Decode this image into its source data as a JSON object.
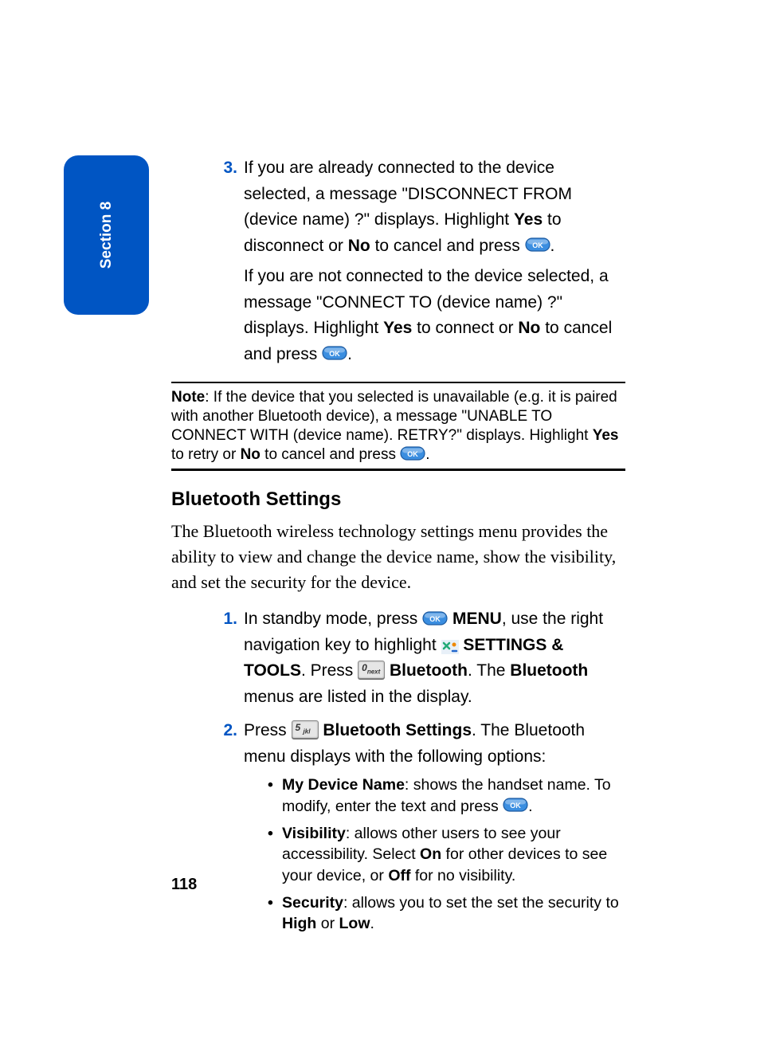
{
  "section_tab": "Section 8",
  "page_number": "118",
  "step3": {
    "marker": "3.",
    "p1_a": "If you are already connected to the device selected, a message \"DISCONNECT FROM (device name) ?\" displays. Highlight ",
    "p1_yes": "Yes",
    "p1_b": " to disconnect or ",
    "p1_no": "No",
    "p1_c": " to cancel and press ",
    "p1_d": ".",
    "p2_a": "If you are not connected to the device selected, a message \"CONNECT TO (device name) ?\" displays. Highlight ",
    "p2_yes": "Yes",
    "p2_b": " to connect or ",
    "p2_no": "No",
    "p2_c": " to cancel and press ",
    "p2_d": "."
  },
  "note": {
    "label": "Note",
    "a": ": If the device that you selected is unavailable (e.g. it is paired with another Bluetooth device), a message \"UNABLE TO CONNECT WITH (device name). RETRY?\" displays. Highlight ",
    "yes": "Yes",
    "b": " to retry or ",
    "no": "No",
    "c": " to cancel and press ",
    "d": "."
  },
  "heading": "Bluetooth Settings",
  "intro": "The Bluetooth wireless technology settings menu provides the ability to view and change the device name, show the visibility, and set the security for the device.",
  "steps": [
    {
      "marker": "1.",
      "parts": {
        "a": "In standby mode, press ",
        "menu": "MENU",
        "b": ", use the right navigation key to highlight ",
        "st": "SETTINGS & TOOLS",
        "c": ". Press ",
        "key1": "0",
        "bt": "Bluetooth",
        "d": ". The ",
        "bt2": "Bluetooth",
        "e": " menus are listed in the display."
      }
    },
    {
      "marker": "2.",
      "parts": {
        "a": "Press ",
        "key2": "5",
        "bs": "Bluetooth Settings",
        "b": ". The Bluetooth menu displays with the following options:"
      }
    }
  ],
  "options": [
    {
      "name": "My Device Name",
      "a": ": shows the handset name. To modify, enter the text and press ",
      "b": "."
    },
    {
      "name": "Visibility",
      "a": ": allows other users to see your accessibility. Select ",
      "on": "On",
      "b": " for other devices to see your device, or ",
      "off": "Off",
      "c": " for no visibility."
    },
    {
      "name": "Security",
      "a": ": allows you to set the set the security to ",
      "high": "High",
      "b": " or ",
      "low": "Low",
      "c": "."
    }
  ]
}
